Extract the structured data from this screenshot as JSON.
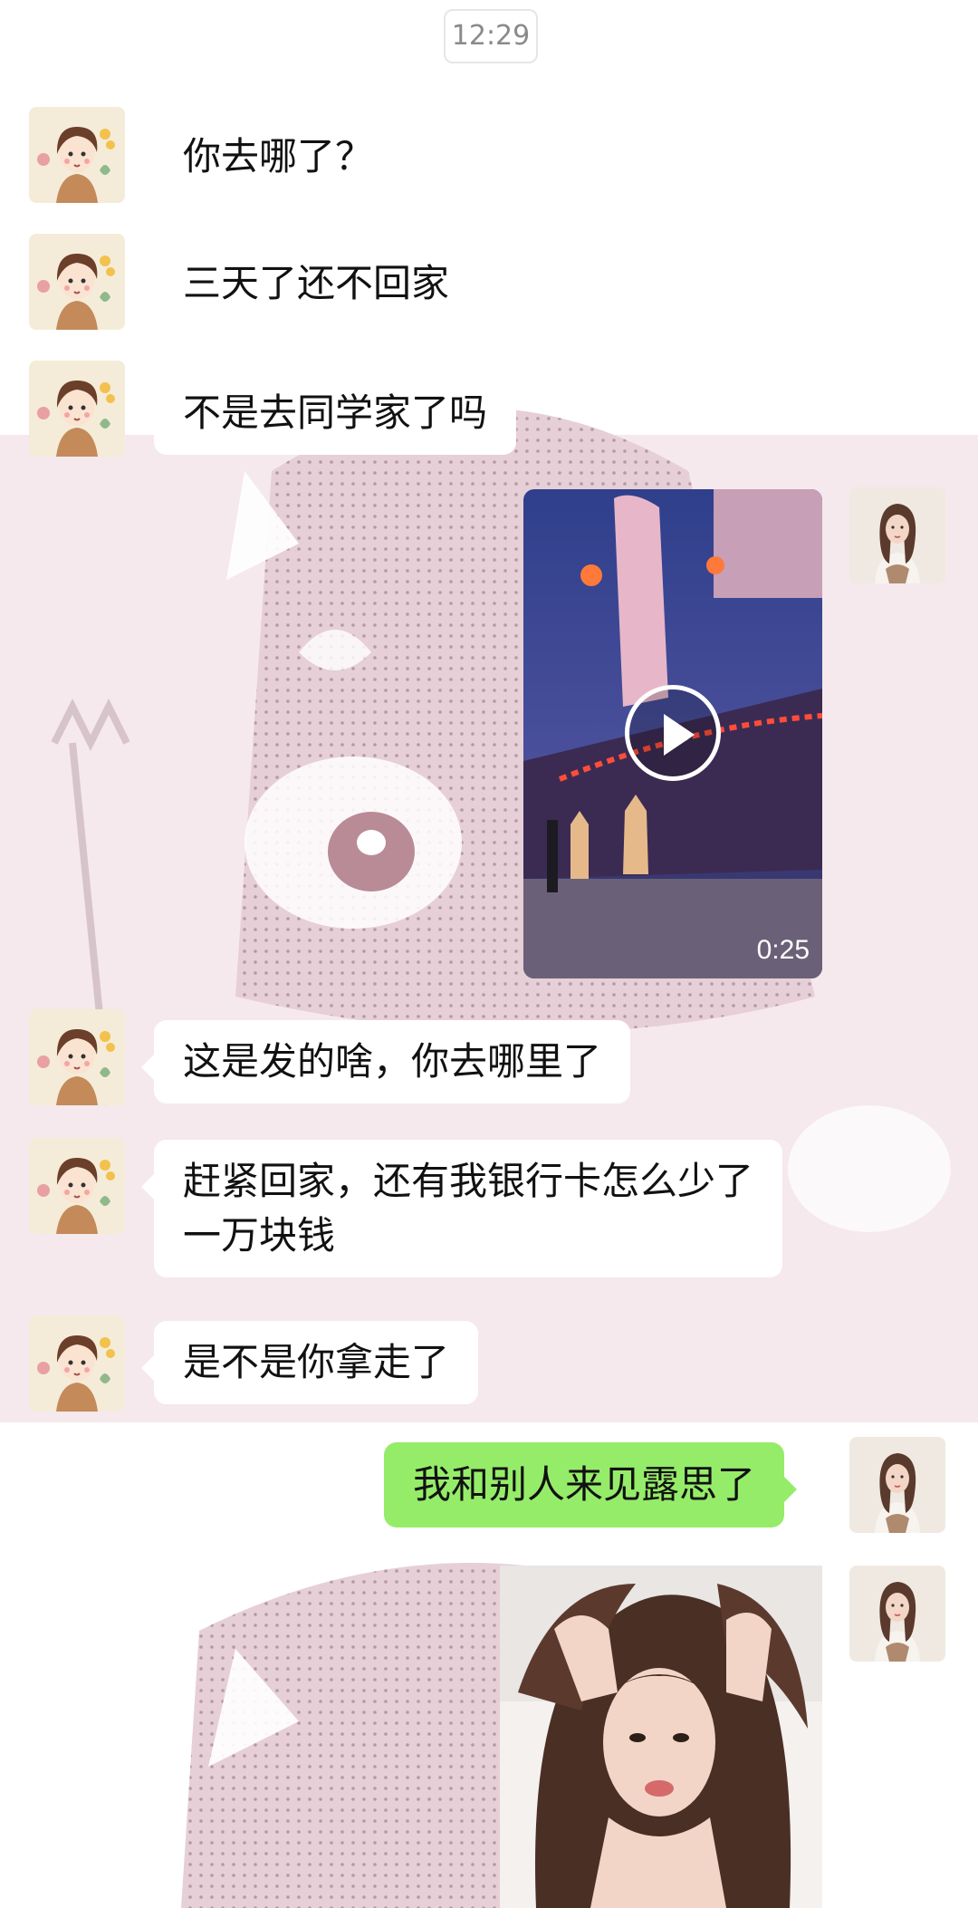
{
  "status": {
    "time": "12:29"
  },
  "theme": {
    "bubble_left": "#ffffff",
    "bubble_right": "#95ec69",
    "wallpaper_tint": "#c9a8b2"
  },
  "messages": [
    {
      "side": "left",
      "avatar": "cartoon-girl-avatar",
      "lines": [
        "你去哪了？"
      ]
    },
    {
      "side": "left",
      "avatar": "cartoon-girl-avatar",
      "lines": [
        "三天了还不回家"
      ]
    },
    {
      "side": "left",
      "avatar": "cartoon-girl-avatar",
      "lines": [
        "不是去同学家了吗"
      ]
    },
    {
      "side": "right",
      "avatar": "girl-photo-avatar",
      "type": "video",
      "duration": "0:25"
    },
    {
      "side": "left",
      "avatar": "cartoon-girl-avatar",
      "lines": [
        "这是发的啥，你去哪里了"
      ]
    },
    {
      "side": "left",
      "avatar": "cartoon-girl-avatar",
      "lines": [
        "赶紧回家，还有我银行卡怎么少了",
        "一万块钱"
      ]
    },
    {
      "side": "left",
      "avatar": "cartoon-girl-avatar",
      "lines": [
        "是不是你拿走了"
      ]
    },
    {
      "side": "right",
      "avatar": "girl-photo-avatar",
      "lines": [
        "我和别人来见露思了"
      ]
    },
    {
      "side": "right",
      "avatar": "girl-photo-avatar",
      "type": "image"
    }
  ]
}
